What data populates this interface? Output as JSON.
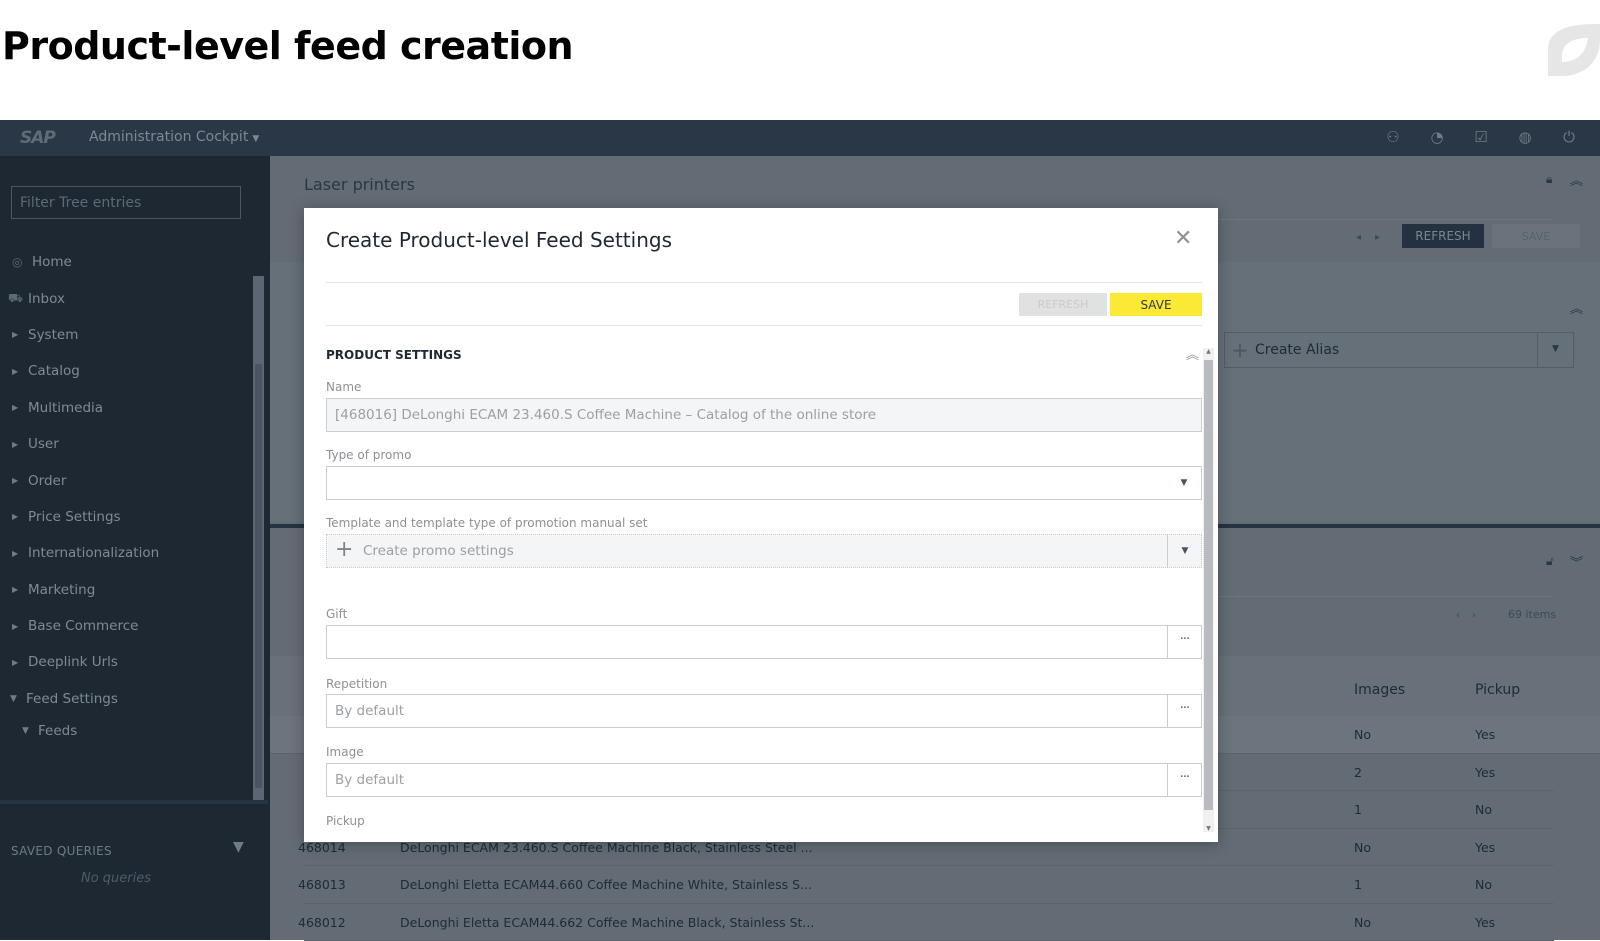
{
  "page": {
    "title": "Product-level feed creation",
    "logo_icon": "leaf-logo-icon"
  },
  "topbar": {
    "logo": "SAP",
    "app_name": "Administration Cockpit",
    "icons": [
      "user-lock-icon",
      "help-gauge-icon",
      "tasks-check-icon",
      "globe-icon",
      "power-icon"
    ]
  },
  "sidebar": {
    "filter_placeholder": "Filter Tree entries",
    "items": [
      {
        "label": "Home",
        "icon": "home-icon"
      },
      {
        "label": "Inbox",
        "icon": "inbox-icon"
      },
      {
        "label": "System"
      },
      {
        "label": "Catalog"
      },
      {
        "label": "Multimedia"
      },
      {
        "label": "User"
      },
      {
        "label": "Order"
      },
      {
        "label": "Price Settings"
      },
      {
        "label": "Internationalization"
      },
      {
        "label": "Marketing"
      },
      {
        "label": "Base Commerce"
      },
      {
        "label": "Deeplink Urls"
      },
      {
        "label": "Feed Settings",
        "expanded": true
      },
      {
        "label": "Feeds",
        "expanded": true
      }
    ],
    "saved_queries_title": "SAVED QUERIES",
    "no_queries": "No queries"
  },
  "main": {
    "title": "Laser printers",
    "refresh_label": "REFRESH",
    "save_label": "SAVE",
    "create_alias_label": "Create Alias",
    "items_count": "69 items",
    "table": {
      "columns": [
        "Images",
        "Pickup"
      ],
      "rows": [
        {
          "id": "",
          "name": "",
          "images": "No",
          "pickup": "Yes"
        },
        {
          "id": "",
          "name": "",
          "images": "2",
          "pickup": "Yes"
        },
        {
          "id": "",
          "name": "",
          "images": "1",
          "pickup": "No"
        },
        {
          "id": "468014",
          "name": "DeLonghi ECAM 23.460.S Coffee Machine Black, Stainless Steel ...",
          "images": "No",
          "pickup": "Yes"
        },
        {
          "id": "468013",
          "name": "DeLonghi Eletta ECAM44.660 Coffee Machine White, Stainless S...",
          "images": "1",
          "pickup": "No"
        },
        {
          "id": "468012",
          "name": "DeLonghi Eletta ECAM44.662 Coffee Machine Black, Stainless St...",
          "images": "No",
          "pickup": "Yes"
        }
      ]
    }
  },
  "modal": {
    "title": "Create Product-level Feed Settings",
    "refresh_label": "REFRESH",
    "save_label": "SAVE",
    "save_color": "#fbe935",
    "section_title": "PRODUCT SETTINGS",
    "fields": {
      "name": {
        "label": "Name",
        "value": "[468016] DeLonghi ECAM 23.460.S Coffee Machine – Catalog of the online store"
      },
      "type_of_promo": {
        "label": "Type of promo",
        "value": ""
      },
      "template": {
        "label": "Template and template type of promotion manual set",
        "value": "Create promo settings"
      },
      "gift": {
        "label": "Gift",
        "value": ""
      },
      "repetition": {
        "label": "Repetition",
        "placeholder": "By default"
      },
      "image": {
        "label": "Image",
        "placeholder": "By default"
      },
      "pickup": {
        "label": "Pickup"
      }
    }
  }
}
